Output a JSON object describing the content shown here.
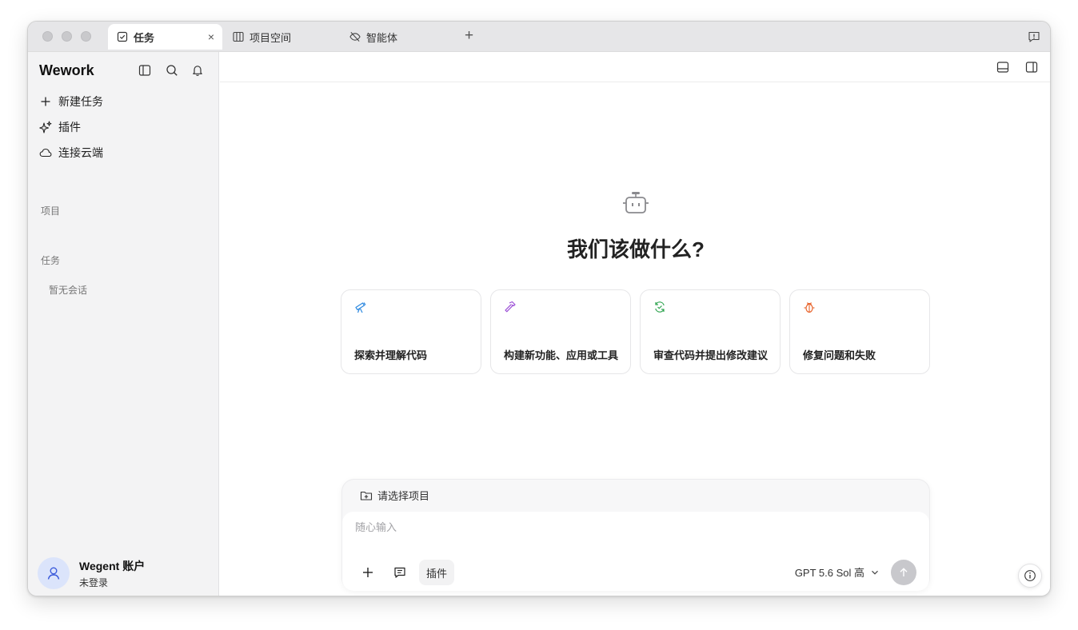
{
  "tabs": [
    {
      "label": "任务",
      "icon": "checkbox-icon",
      "active": true,
      "close": "×"
    },
    {
      "label": "项目空间",
      "icon": "columns-icon",
      "active": false
    },
    {
      "label": "智能体",
      "icon": "eye-off-icon",
      "active": false
    }
  ],
  "titlebar": {
    "new_tab": "+"
  },
  "sidebar": {
    "brand": "Wework",
    "nav": [
      {
        "label": "新建任务",
        "icon": "plus-icon"
      },
      {
        "label": "插件",
        "icon": "sparkle-icon"
      },
      {
        "label": "连接云端",
        "icon": "cloud-icon"
      }
    ],
    "projects_label": "项目",
    "tasks_label": "任务",
    "empty_tasks": "暂无会话",
    "account": {
      "name": "Wegent 账户",
      "status": "未登录"
    }
  },
  "main": {
    "headline": "我们该做什么?",
    "cards": [
      {
        "label": "探索并理解代码",
        "icon": "telescope-icon",
        "color": "#2f8ae0"
      },
      {
        "label": "构建新功能、应用或工具",
        "icon": "hammer-icon",
        "color": "#9b4fd6"
      },
      {
        "label": "审查代码并提出修改建议",
        "icon": "refresh-check-icon",
        "color": "#2ea44f"
      },
      {
        "label": "修复问题和失败",
        "icon": "bug-icon",
        "color": "#e8642c"
      }
    ],
    "composer": {
      "project_placeholder": "请选择项目",
      "input_placeholder": "随心输入",
      "plugin_chip": "插件",
      "model": "GPT 5.6 Sol 高"
    }
  }
}
